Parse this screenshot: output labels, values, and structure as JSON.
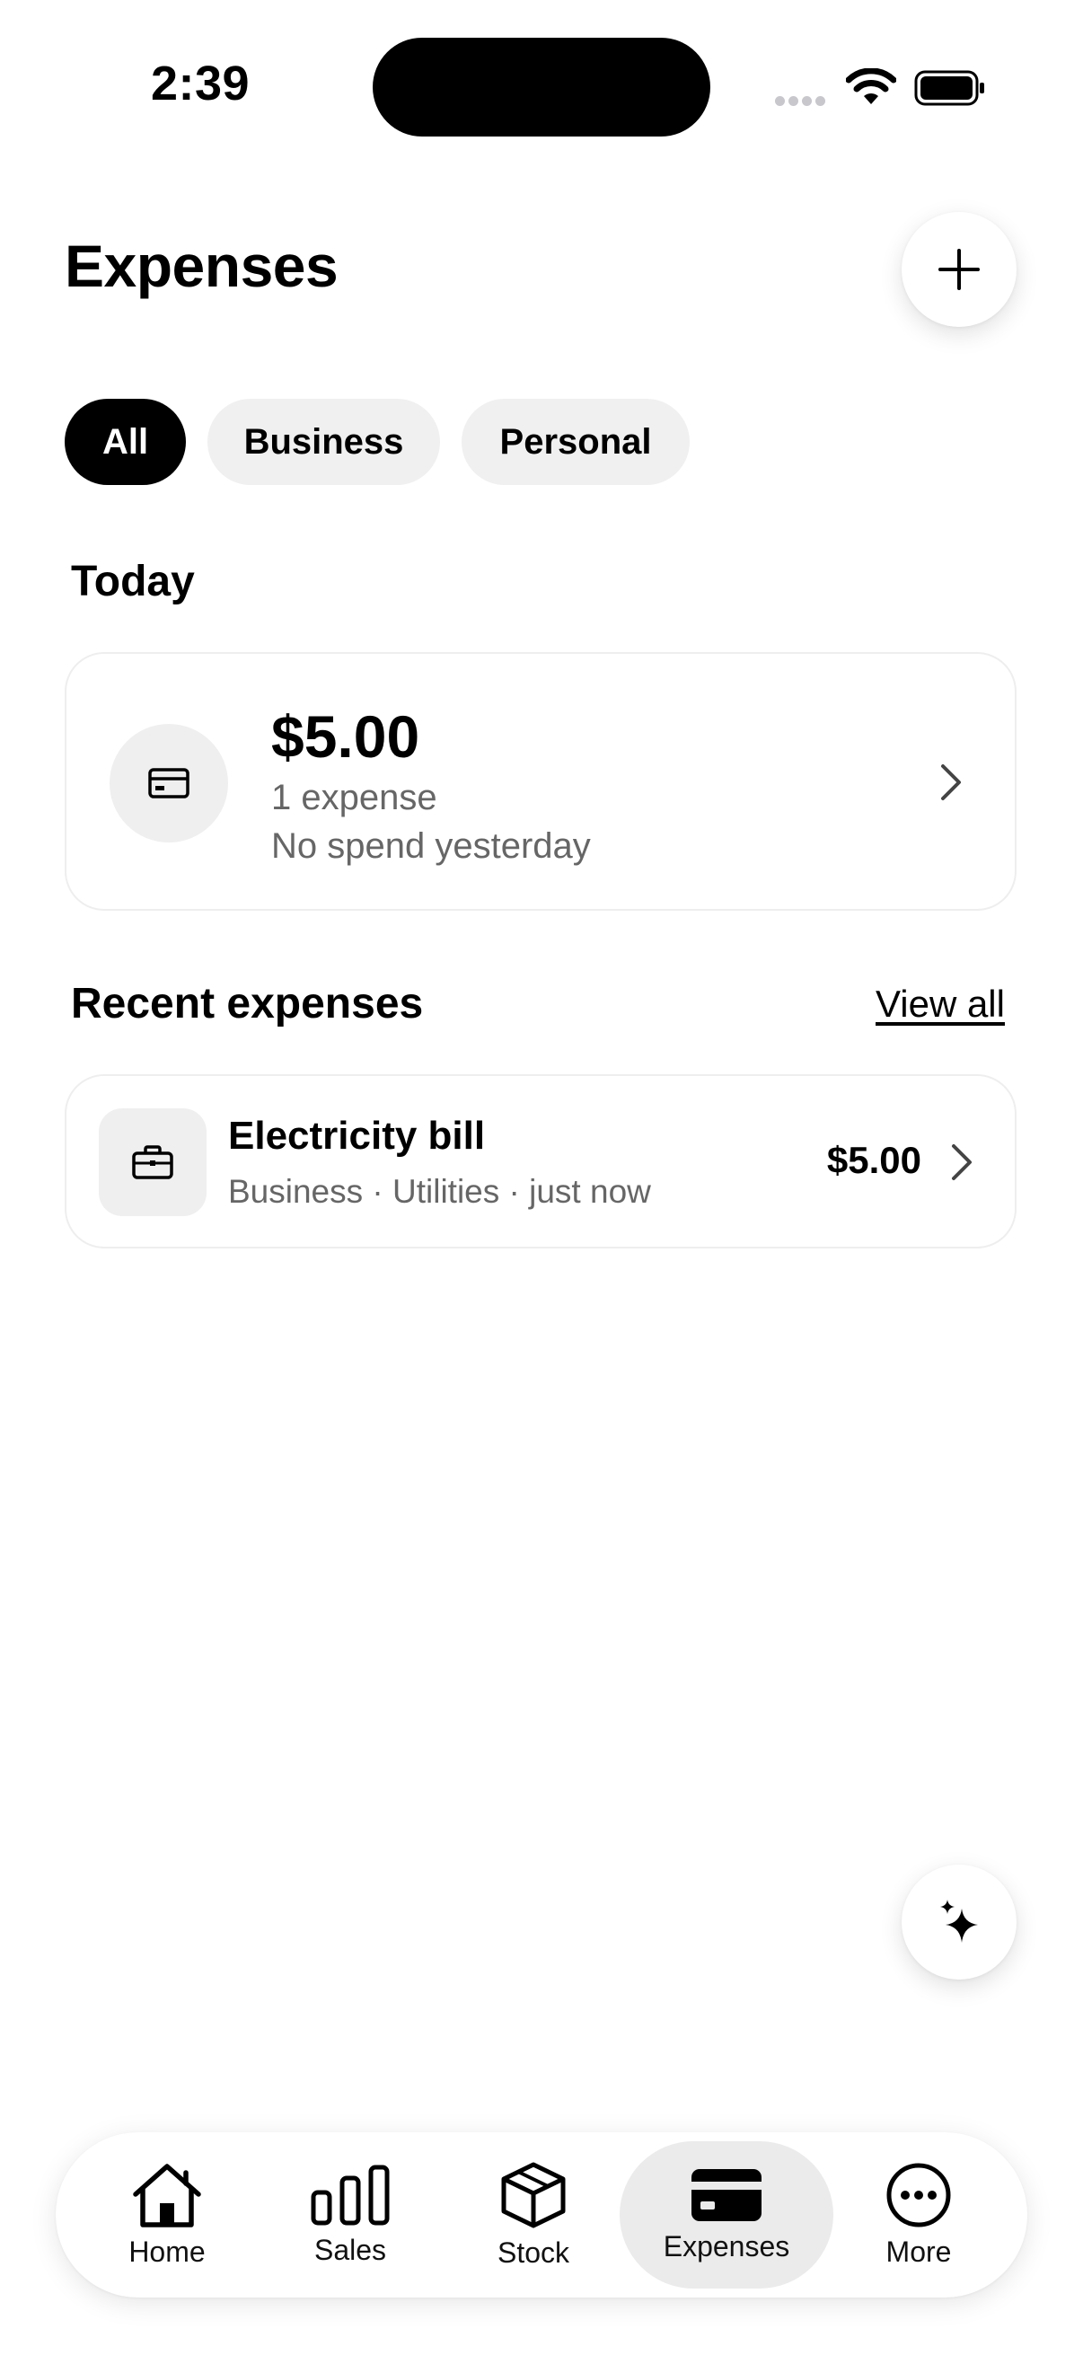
{
  "status_bar": {
    "time": "2:39"
  },
  "header": {
    "title": "Expenses"
  },
  "filters": [
    {
      "label": "All",
      "selected": true
    },
    {
      "label": "Business",
      "selected": false
    },
    {
      "label": "Personal",
      "selected": false
    }
  ],
  "today": {
    "heading": "Today",
    "total": "$5.00",
    "count": "1 expense",
    "comparison": "No spend yesterday",
    "icon": "credit-card-icon"
  },
  "recent": {
    "heading": "Recent expenses",
    "view_all": "View all",
    "items": [
      {
        "title": "Electricity bill",
        "meta": "Business · Utilities · just now",
        "amount": "$5.00",
        "icon": "briefcase-icon"
      }
    ]
  },
  "tabs": [
    {
      "label": "Home",
      "icon": "home-icon"
    },
    {
      "label": "Sales",
      "icon": "bar-chart-icon"
    },
    {
      "label": "Stock",
      "icon": "box-icon"
    },
    {
      "label": "Expenses",
      "icon": "credit-card-icon",
      "active": true
    },
    {
      "label": "More",
      "icon": "more-icon"
    }
  ],
  "colors": {
    "accent": "#000000",
    "chip_bg": "#f0f0f0",
    "muted_text": "#666666",
    "active_tab_bg": "#ebebeb"
  }
}
